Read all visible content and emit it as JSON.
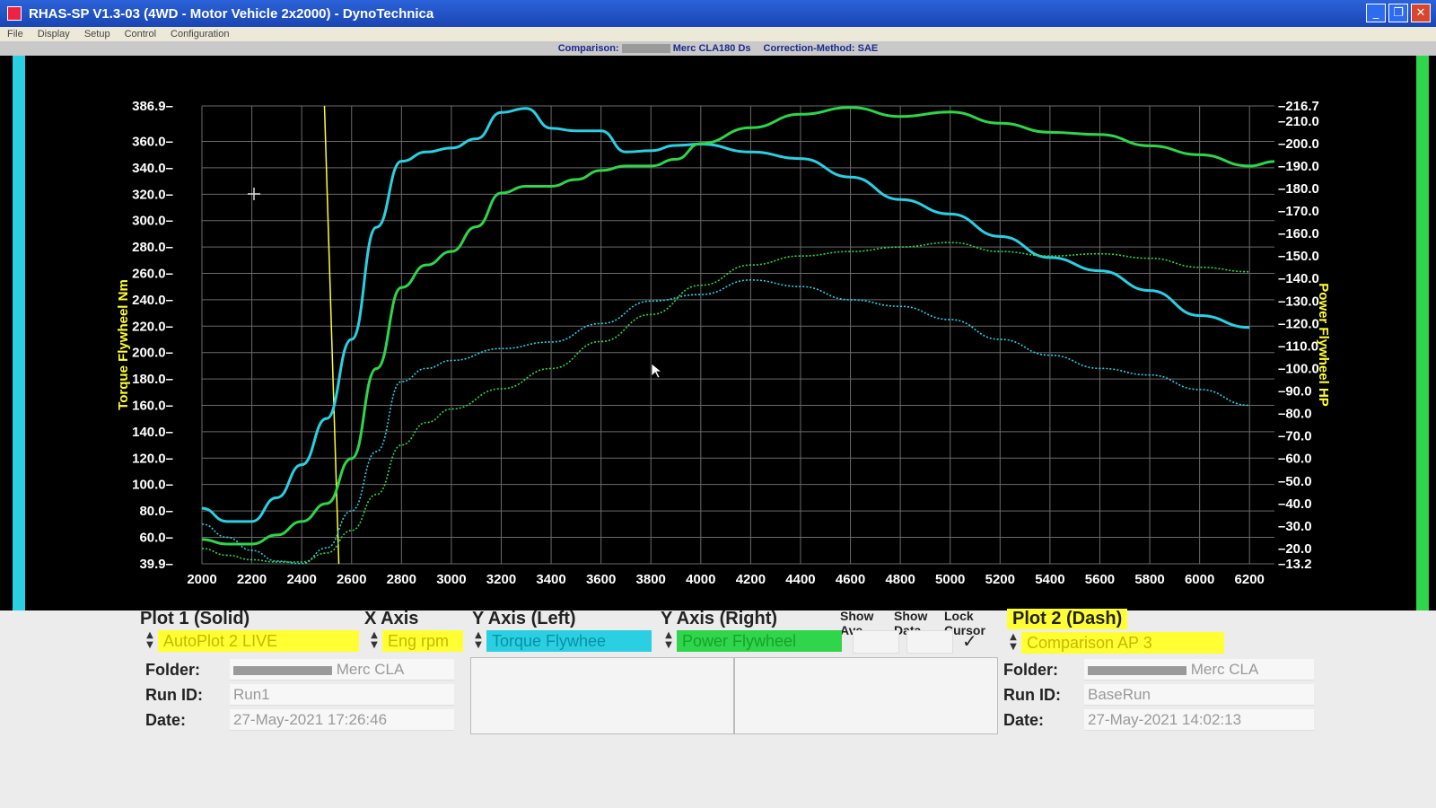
{
  "window": {
    "title": "RHAS-SP V1.3-03  (4WD - Motor Vehicle 2x2000) - DynoTechnica",
    "controls": {
      "minimize": "_",
      "maximize": "❐",
      "close": "✕"
    }
  },
  "menu": [
    "File",
    "Display",
    "Setup",
    "Control",
    "Configuration"
  ],
  "infobar": {
    "comparison_label": "Comparison:",
    "comparison_value": "Merc CLA180 Ds",
    "correction_label": "Correction-Method: SAE"
  },
  "colors": {
    "torque": "#2ad0e2",
    "power": "#2fd54a",
    "grid": "#6a6a6a",
    "accent": "#ffff33"
  },
  "chart_data": {
    "type": "line",
    "ylabel_left": "Torque Flywheel Nm",
    "ylabel_right": "Power Flywheel HP",
    "xlim": [
      2000,
      6300
    ],
    "ylim_left": [
      39.9,
      386.9
    ],
    "ylim_right": [
      13.2,
      216.7
    ],
    "x_ticks": [
      2000,
      2200,
      2400,
      2600,
      2800,
      3000,
      3200,
      3400,
      3600,
      3800,
      4000,
      4200,
      4400,
      4600,
      4800,
      5000,
      5200,
      5400,
      5600,
      5800,
      6000,
      6200
    ],
    "y_left_ticks": [
      {
        "v": 39.9,
        "label": "39.9"
      },
      {
        "v": 60,
        "label": "60.0"
      },
      {
        "v": 80,
        "label": "80.0"
      },
      {
        "v": 100,
        "label": "100.0"
      },
      {
        "v": 120,
        "label": "120.0"
      },
      {
        "v": 140,
        "label": "140.0"
      },
      {
        "v": 160,
        "label": "160.0"
      },
      {
        "v": 180,
        "label": "180.0"
      },
      {
        "v": 200,
        "label": "200.0"
      },
      {
        "v": 220,
        "label": "220.0"
      },
      {
        "v": 240,
        "label": "240.0"
      },
      {
        "v": 260,
        "label": "260.0"
      },
      {
        "v": 280,
        "label": "280.0"
      },
      {
        "v": 300,
        "label": "300.0"
      },
      {
        "v": 320,
        "label": "320.0"
      },
      {
        "v": 340,
        "label": "340.0"
      },
      {
        "v": 360,
        "label": "360.0"
      },
      {
        "v": 386.9,
        "label": "386.9"
      }
    ],
    "y_right_ticks": [
      {
        "v": 13.2,
        "label": "13.2"
      },
      {
        "v": 20,
        "label": "20.0"
      },
      {
        "v": 30,
        "label": "30.0"
      },
      {
        "v": 40,
        "label": "40.0"
      },
      {
        "v": 50,
        "label": "50.0"
      },
      {
        "v": 60,
        "label": "60.0"
      },
      {
        "v": 70,
        "label": "70.0"
      },
      {
        "v": 80,
        "label": "80.0"
      },
      {
        "v": 90,
        "label": "90.0"
      },
      {
        "v": 100,
        "label": "100.0"
      },
      {
        "v": 110,
        "label": "110.0"
      },
      {
        "v": 120,
        "label": "120.0"
      },
      {
        "v": 130,
        "label": "130.0"
      },
      {
        "v": 140,
        "label": "140.0"
      },
      {
        "v": 150,
        "label": "150.0"
      },
      {
        "v": 160,
        "label": "160.0"
      },
      {
        "v": 170,
        "label": "170.0"
      },
      {
        "v": 180,
        "label": "180.0"
      },
      {
        "v": 190,
        "label": "190.0"
      },
      {
        "v": 200,
        "label": "200.0"
      },
      {
        "v": 210,
        "label": "210.0"
      },
      {
        "v": 216.7,
        "label": "216.7"
      }
    ],
    "cursor_x": 2520,
    "grid": true,
    "series": [
      {
        "axis": "left",
        "style": "solid",
        "color": "#2ad0e2",
        "x": [
          2000,
          2100,
          2200,
          2300,
          2400,
          2500,
          2600,
          2700,
          2800,
          2900,
          3000,
          3100,
          3200,
          3300,
          3400,
          3500,
          3600,
          3700,
          3800,
          3900,
          4000,
          4200,
          4400,
          4600,
          4800,
          5000,
          5200,
          5400,
          5600,
          5800,
          6000,
          6200
        ],
        "y": [
          82,
          72,
          72,
          90,
          115,
          150,
          210,
          295,
          345,
          352,
          355,
          362,
          382,
          385,
          370,
          368,
          368,
          352,
          353,
          357,
          358,
          352,
          347,
          333,
          316,
          305,
          288,
          272,
          262,
          247,
          228,
          219
        ]
      },
      {
        "axis": "right",
        "style": "solid",
        "color": "#2fd54a",
        "x": [
          2000,
          2100,
          2200,
          2300,
          2400,
          2500,
          2600,
          2700,
          2800,
          2900,
          3000,
          3100,
          3200,
          3300,
          3400,
          3500,
          3600,
          3700,
          3800,
          3900,
          4000,
          4200,
          4400,
          4600,
          4800,
          5000,
          5200,
          5400,
          5600,
          5800,
          6000,
          6200,
          6300
        ],
        "y": [
          24,
          22,
          22,
          26,
          32,
          40,
          60,
          100,
          136,
          146,
          152,
          163,
          178,
          181,
          181,
          184,
          188,
          190,
          190,
          193,
          200,
          207,
          213,
          216,
          212,
          214,
          209,
          205,
          204,
          199,
          195,
          190,
          192
        ]
      },
      {
        "axis": "left",
        "style": "dash",
        "color": "#2ad0e2",
        "x": [
          2000,
          2100,
          2200,
          2300,
          2400,
          2500,
          2600,
          2700,
          2800,
          2900,
          3000,
          3200,
          3400,
          3600,
          3800,
          4000,
          4200,
          4400,
          4600,
          4800,
          5000,
          5200,
          5400,
          5600,
          5800,
          6000,
          6200
        ],
        "y": [
          70,
          60,
          50,
          42,
          40,
          52,
          80,
          125,
          178,
          188,
          194,
          203,
          208,
          222,
          239,
          244,
          255,
          250,
          240,
          235,
          225,
          210,
          198,
          188,
          183,
          172,
          160
        ]
      },
      {
        "axis": "right",
        "style": "dash",
        "color": "#2fd54a",
        "x": [
          2000,
          2100,
          2200,
          2300,
          2400,
          2500,
          2600,
          2700,
          2800,
          2900,
          3000,
          3200,
          3400,
          3600,
          3800,
          4000,
          4200,
          4400,
          4600,
          4800,
          5000,
          5200,
          5400,
          5600,
          5800,
          6000,
          6200
        ],
        "y": [
          20,
          17,
          15,
          14,
          14,
          18,
          28,
          44,
          66,
          76,
          82,
          91,
          100,
          112,
          124,
          137,
          146,
          150,
          152,
          154,
          156,
          152,
          150,
          151,
          149,
          145,
          143
        ]
      }
    ]
  },
  "panel": {
    "plot1_header": "Plot 1 (Solid)",
    "xaxis_header": "X Axis",
    "yleft_header": "Y Axis (Left)",
    "yright_header": "Y Axis (Right)",
    "show_ave_header": "Show\nAve.",
    "show_data_header": "Show\nData",
    "lock_cursor_header": "Lock\nCursor",
    "plot2_header": "Plot 2 (Dash)",
    "plot1_select": "AutoPlot 2 LIVE",
    "xaxis_select": "Eng rpm",
    "yleft_select": "Torque Flywhee",
    "yright_select": "Power Flywheel",
    "plot2_select": "Comparison AP 3",
    "lock_cursor_check": "✓",
    "folder_label": "Folder:",
    "runid_label": "Run ID:",
    "date_label": "Date:",
    "plot1_folder": "Merc CLA",
    "plot1_runid": "Run1",
    "plot1_date": "27-May-2021  17:26:46",
    "plot2_folder": "Merc CLA",
    "plot2_runid": "BaseRun",
    "plot2_date": "27-May-2021  14:02:13"
  }
}
